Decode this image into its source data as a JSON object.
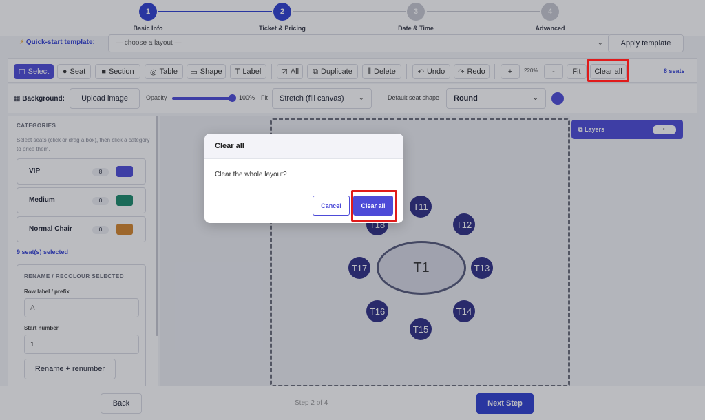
{
  "stepper": {
    "steps": [
      {
        "num": "1",
        "label": "Basic Info"
      },
      {
        "num": "2",
        "label": "Ticket & Pricing"
      },
      {
        "num": "3",
        "label": "Date & Time"
      },
      {
        "num": "4",
        "label": "Advanced"
      }
    ]
  },
  "template": {
    "label": "Quick-start template:",
    "select_value": "— choose a layout —",
    "apply_label": "Apply template"
  },
  "toolbar": {
    "select": "Select",
    "seat": "Seat",
    "section": "Section",
    "table": "Table",
    "shape": "Shape",
    "label": "Label",
    "all": "All",
    "duplicate": "Duplicate",
    "delete": "Delete",
    "undo": "Undo",
    "redo": "Redo",
    "zoom_in": "+",
    "zoom_level": "220%",
    "zoom_out": "-",
    "fit": "Fit",
    "clear_all": "Clear all",
    "seat_count": "8 seats"
  },
  "background": {
    "label": "Background:",
    "upload": "Upload image",
    "opacity_label": "Opacity",
    "opacity_value": "100%",
    "fit_label": "Fit",
    "fit_value": "Stretch (fill canvas)",
    "shape_label": "Default seat shape",
    "shape_value": "Round",
    "seat_color": "#4d4bd8"
  },
  "categories": {
    "heading": "CATEGORIES",
    "hint": "Select seats (click or drag a box), then click a category to price them.",
    "items": [
      {
        "name": "VIP",
        "count": "8",
        "color": "#4d4bd8"
      },
      {
        "name": "Medium",
        "count": "0",
        "color": "#1a8a6a"
      },
      {
        "name": "Normal Chair",
        "count": "0",
        "color": "#d4862b"
      }
    ],
    "selected_count": "9 seat(s) selected"
  },
  "rename": {
    "heading": "RENAME / RECOLOUR SELECTED",
    "row_label": "Row label / prefix",
    "row_placeholder": "A",
    "start_label": "Start number",
    "start_value": "1",
    "button": "Rename + renumber"
  },
  "canvas": {
    "table_label": "T1",
    "seats": [
      "T11",
      "T12",
      "T13",
      "T14",
      "T15",
      "T16",
      "T17",
      "T18"
    ]
  },
  "layers": {
    "label": "Layers",
    "toggle": "▸"
  },
  "footer": {
    "back": "Back",
    "step_text": "Step 2 of 4",
    "next": "Next Step"
  },
  "modal": {
    "title": "Clear all",
    "message": "Clear the whole layout?",
    "cancel": "Cancel",
    "confirm": "Clear all"
  },
  "colors": {
    "accent": "#4d4bd8",
    "primary": "#2f3fd1",
    "highlight": "#e01b1b"
  }
}
